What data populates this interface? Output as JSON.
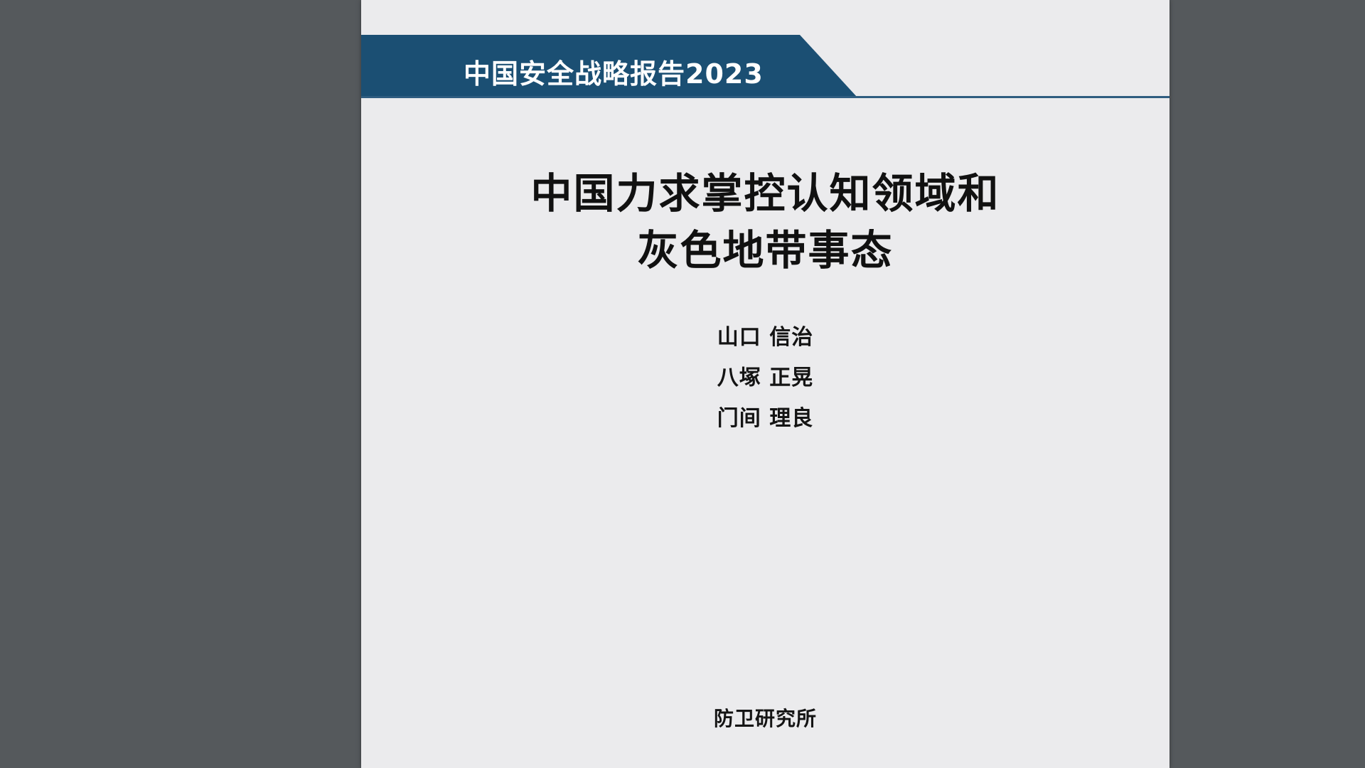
{
  "document": {
    "series_title": "中国安全战略报告2023",
    "title_lines": [
      "中国力求掌控认知领域和",
      "灰色地带事态"
    ],
    "authors": [
      "山口 信治",
      "八塚 正晃",
      "门间 理良"
    ],
    "publisher": "防卫研究所"
  },
  "colors": {
    "viewer_background": "#55595c",
    "page_background": "#ebebed",
    "banner": "#1b4f73",
    "text": "#111111"
  }
}
